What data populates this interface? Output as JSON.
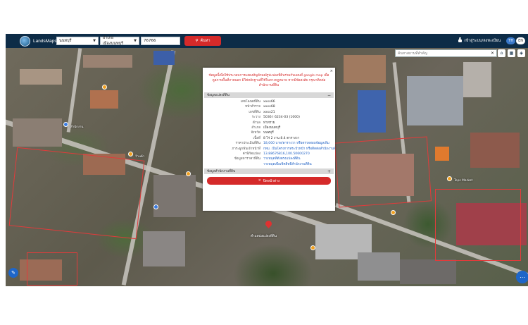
{
  "header": {
    "app_name": "LandsMaps",
    "province": "นนทบุรี",
    "district": "อำเภอเมืองนนทบุรี",
    "parcel_no": "76766",
    "search_label": "ค้นหา",
    "login_label": "เข้าสู่ระบบ/ลงทะเบียน",
    "lang_th": "TH",
    "lang_en": "EN"
  },
  "map": {
    "search_placeholder": "ค้นหาสถานที่สำคัญ",
    "pin_label": "ตำแหน่งแปลงที่ดิน",
    "places": [
      "Tops Market",
      "สำนักงาน",
      "ร้านค้า"
    ]
  },
  "popup": {
    "note": "ข้อมูลนี้เพื่อใช้ประกอบการแสดงสัญลักษณ์รูปแปลงที่ดินร่วมกับแผนที่ google map เพื่อดูสภาพพื้นที่ภายนอก มิใช่หลักฐานที่ใช้ในทางกฎหมาย หากมีข้อสงสัย กรุณาติดต่อสำนักงานที่ดิน",
    "section1_title": "ข้อมูลแปลงที่ดิน",
    "section2_title": "ข้อมูลสำนักงานที่ดิน",
    "section1_toggle": "−",
    "section2_toggle": "+",
    "rows": [
      {
        "k": "เลขโฉนดที่ดิน",
        "v": "xxxx66"
      },
      {
        "k": "หน้าสำรวจ",
        "v": "xxxx68"
      },
      {
        "k": "เลขที่ดิน",
        "v": "xxxx21"
      },
      {
        "k": "ระวาง",
        "v": "5036 I 6234-03 (1000)"
      },
      {
        "k": "ตำบล",
        "v": "ท่าทราย"
      },
      {
        "k": "อำเภอ",
        "v": "เมืองนนทบุรี"
      },
      {
        "k": "จังหวัด",
        "v": "นนทบุรี"
      },
      {
        "k": "เนื้อที่",
        "v": "8 ไร่ 2 งาน 8.4 ตารางวา"
      },
      {
        "k": "ราคาประเมินที่ดิน",
        "v": "18,000 บาท/ตารางวา หรือตรวจสอบข้อมูลเพิ่ม"
      },
      {
        "k": "ภาระผูกพันเจ้าหน้าที่",
        "v": "กทม. เป็นโครงการสระบัวหน้า หรือติดต่อสำนักงานที่ดิน"
      },
      {
        "k": "ค่าพิกัดแปลง",
        "v": "13.88676816,100.50600270"
      },
      {
        "k": "ข้อมูลหาราคาที่ดิน",
        "v": "วางหมุดที่ตั้งตรงแปลงที่ดิน"
      },
      {
        "k": "",
        "v": "วางหมุดเพื่อเช็คสิทธิ์สำนักงานที่ดิน"
      }
    ],
    "close_label": "ปิดหน้าต่าง",
    "close_icon": "×"
  },
  "colors": {
    "header_bg": "#0d2c47",
    "accent_red": "#d52a2a",
    "fab_blue": "#1e66c9"
  }
}
